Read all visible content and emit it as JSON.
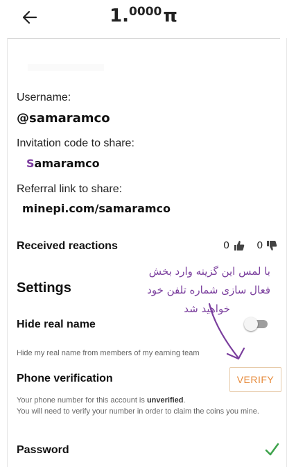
{
  "header": {
    "balance_int": "1.",
    "balance_dec": "0000",
    "currency_symbol": "π",
    "back_icon": "arrow-left-icon"
  },
  "profile": {
    "username_label": "Username:",
    "username_value": "@samaramco",
    "invitation_label": "Invitation code to share:",
    "invitation_first": "S",
    "invitation_rest": "amaramco",
    "referral_label": "Referral link to share:",
    "referral_value": "minepi.com/samaramco"
  },
  "reactions": {
    "label": "Received reactions",
    "likes": "0",
    "dislikes": "0",
    "like_icon": "thumbs-up-icon",
    "dislike_icon": "thumbs-down-icon"
  },
  "settings": {
    "title": "Settings",
    "hide_real_name": {
      "label": "Hide real name",
      "description": "Hide my real name from members of my earning team",
      "enabled": false
    },
    "phone_verification": {
      "label": "Phone verification",
      "button": "VERIFY",
      "desc_prefix": "Your phone number for this account is ",
      "desc_status": "unverified",
      "desc_suffix": ".",
      "desc_line2": "You will need to verify your number in order to claim the coins you mine."
    },
    "password": {
      "label": "Password",
      "status_icon": "checkmark-icon"
    }
  },
  "annotation": {
    "line1": "با لمس این گزینه وارد بخش",
    "line2": "فعال سازی شماره تلفن خود",
    "line3": "خواهید شد"
  },
  "colors": {
    "accent_orange": "#e68a3a",
    "annotation_purple": "#7a3e9d",
    "check_green": "#3fa34d",
    "invite_first_letter": "#7b3b9e"
  }
}
